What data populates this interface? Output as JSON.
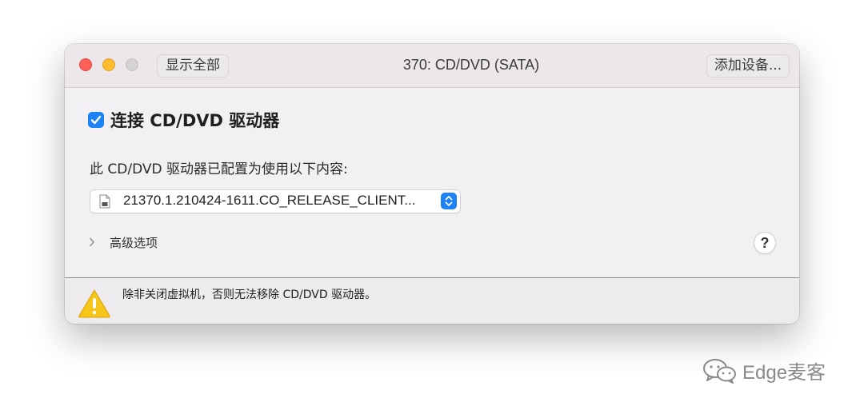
{
  "window": {
    "title": "370: CD/DVD (SATA)",
    "show_all_label": "显示全部",
    "add_device_label": "添加设备..."
  },
  "cd_dvd": {
    "connect_checked": true,
    "connect_label": "连接 CD/DVD 驱动器",
    "config_label": "此 CD/DVD 驱动器已配置为使用以下内容:",
    "selected_image": "21370.1.210424-1611.CO_RELEASE_CLIENT..."
  },
  "advanced": {
    "label": "高级选项"
  },
  "help": {
    "label": "?"
  },
  "footer": {
    "warning_text": "除非关闭虚拟机，否则无法移除 CD/DVD 驱动器。"
  },
  "watermark": {
    "text": "Edge麦客"
  },
  "colors": {
    "accent": "#1d82f5",
    "close": "#fe5f57",
    "minimize": "#febc2e",
    "maximize_disabled": "#d4d2d4",
    "warning": "#f5c518"
  },
  "icons": {
    "checkbox": "checkmark-icon",
    "file": "disc-image-file-icon",
    "select": "updown-chevron-icon",
    "advanced": "chevron-right-icon",
    "warning": "warning-triangle-icon",
    "watermark": "wechat-icon"
  }
}
